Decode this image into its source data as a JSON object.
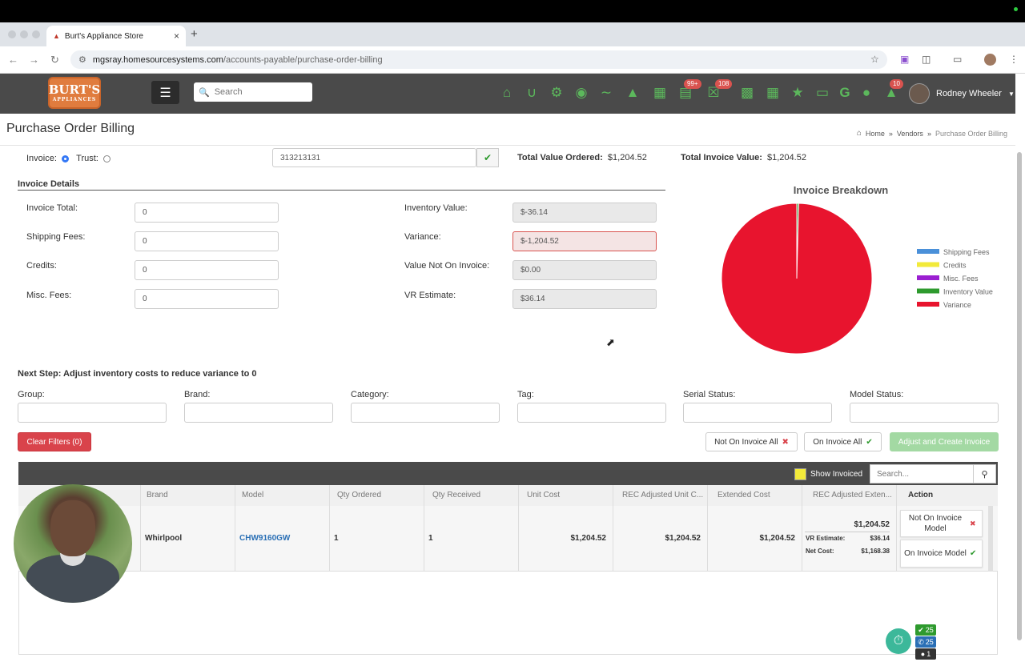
{
  "browser": {
    "tab_title": "Burt's Appliance Store",
    "url_domain": "mgsray.homesourcesystems.com",
    "url_path": "/accounts-payable/purchase-order-billing"
  },
  "header": {
    "logo_text": "BURT'S",
    "logo_sub": "APPLIANCES",
    "search_placeholder": "Search",
    "badge_cart": "99+",
    "badge_cart2": "108",
    "badge_notifications": "10",
    "user_name": "Rodney Wheeler"
  },
  "page": {
    "title": "Purchase Order Billing",
    "breadcrumb": [
      "Home",
      "Vendors",
      "Purchase Order Billing"
    ]
  },
  "form": {
    "invoice_radio_label": "Invoice:",
    "trust_radio_label": "Trust:",
    "invoice_number": "313213131",
    "total_value_ordered_label": "Total Value Ordered:",
    "total_value_ordered": "$1,204.52",
    "total_invoice_value_label": "Total Invoice Value:",
    "total_invoice_value": "$1,204.52",
    "section_title": "Invoice Details",
    "invoice_total_label": "Invoice Total:",
    "invoice_total": "0",
    "shipping_fees_label": "Shipping Fees:",
    "shipping_fees": "0",
    "credits_label": "Credits:",
    "credits": "0",
    "misc_fees_label": "Misc. Fees:",
    "misc_fees": "0",
    "inventory_value_label": "Inventory Value:",
    "inventory_value": "$-36.14",
    "variance_label": "Variance:",
    "variance": "$-1,204.52",
    "value_not_on_invoice_label": "Value Not On Invoice:",
    "value_not_on_invoice": "$0.00",
    "vr_estimate_label": "VR Estimate:",
    "vr_estimate": "$36.14"
  },
  "chart_data": {
    "type": "pie",
    "title": "Invoice Breakdown",
    "legend_position": "right",
    "slices": [
      {
        "name": "Shipping Fees",
        "value": 0,
        "color": "#4a90d9"
      },
      {
        "name": "Credits",
        "value": 0,
        "color": "#f2ea3a"
      },
      {
        "name": "Misc. Fees",
        "value": 0,
        "color": "#9b1fd1"
      },
      {
        "name": "Inventory Value",
        "value": 0.4,
        "color": "#2e9a2e"
      },
      {
        "name": "Variance",
        "value": 99.6,
        "color": "#e8142e"
      }
    ]
  },
  "filters": {
    "next_step": "Next Step: Adjust inventory costs to reduce variance to 0",
    "group_label": "Group:",
    "brand_label": "Brand:",
    "category_label": "Category:",
    "tag_label": "Tag:",
    "serial_status_label": "Serial Status:",
    "model_status_label": "Model Status:",
    "clear_filters": "Clear Filters  (0)",
    "not_on_invoice_all": "Not On Invoice All",
    "on_invoice_all": "On Invoice All",
    "adjust_create": "Adjust and Create Invoice"
  },
  "table": {
    "show_invoiced": "Show Invoiced",
    "search_placeholder": "Search...",
    "columns": [
      "Brand",
      "Model",
      "Qty Ordered",
      "Qty Received",
      "Unit Cost",
      "REC Adjusted Unit C...",
      "Extended Cost",
      "REC Adjusted Exten...",
      "Action"
    ],
    "row": {
      "brand": "Whirlpool",
      "model": "CHW9160GW",
      "qty_ordered": "1",
      "qty_received": "1",
      "unit_cost": "$1,204.52",
      "rec_adjusted_unit_cost": "$1,204.52",
      "extended_cost": "$1,204.52",
      "rec_adjusted_extended": "$1,204.52",
      "vr_estimate_label": "VR Estimate:",
      "vr_estimate": "$36.14",
      "net_cost_label": "Net Cost:",
      "net_cost": "$1,168.38",
      "not_on_invoice_model": "Not On Invoice Model",
      "on_invoice_model": "On Invoice Model"
    }
  },
  "widget": {
    "count_check": "25",
    "count_phone": "25",
    "count_chat": "1"
  }
}
